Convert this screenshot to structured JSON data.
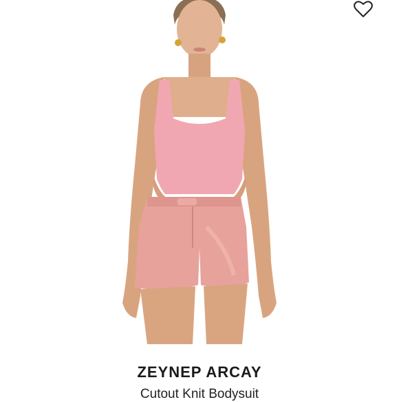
{
  "product": {
    "brand": "ZEYNEP ARCAY",
    "name": "Cutout Knit Bodysuit"
  },
  "icons": {
    "wishlist": "heart-icon"
  },
  "colors": {
    "bodysuit": "#f1a7b2",
    "shorts": "#e7a29b",
    "skin": "#dba884",
    "background": "#ffffff"
  }
}
